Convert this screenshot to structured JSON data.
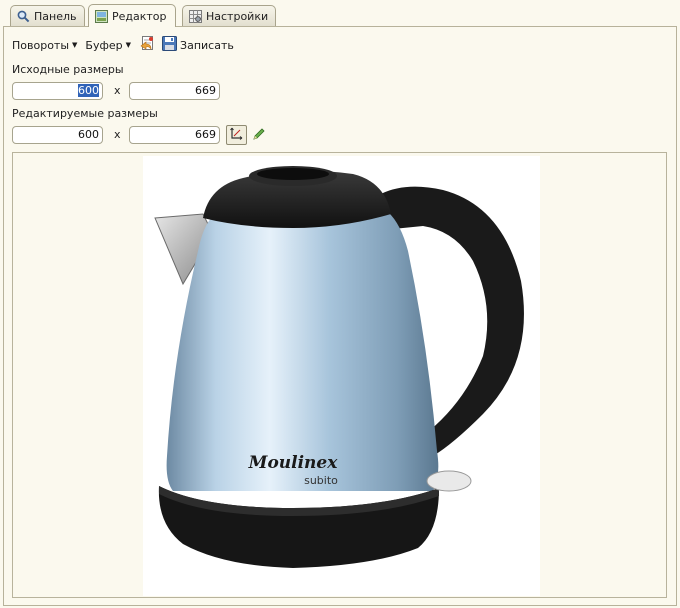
{
  "tabs": [
    {
      "label": "Панель",
      "icon": "magnifier-icon"
    },
    {
      "label": "Редактор",
      "icon": "image-editor-icon"
    },
    {
      "label": "Настройки",
      "icon": "settings-grid-icon"
    }
  ],
  "toolbar": {
    "rotations": "Повороты",
    "buffer": "Буфер",
    "save": "Записать"
  },
  "source_size": {
    "label": "Исходные размеры",
    "width": "600",
    "height": "669",
    "separator": "x"
  },
  "edit_size": {
    "label": "Редактируемые размеры",
    "width": "600",
    "height": "669",
    "separator": "x"
  },
  "image": {
    "brand": "Moulinex",
    "model": "subito"
  },
  "colors": {
    "background": "#fbf9ee",
    "selection": "#3063b8",
    "border": "#b7b29a"
  }
}
